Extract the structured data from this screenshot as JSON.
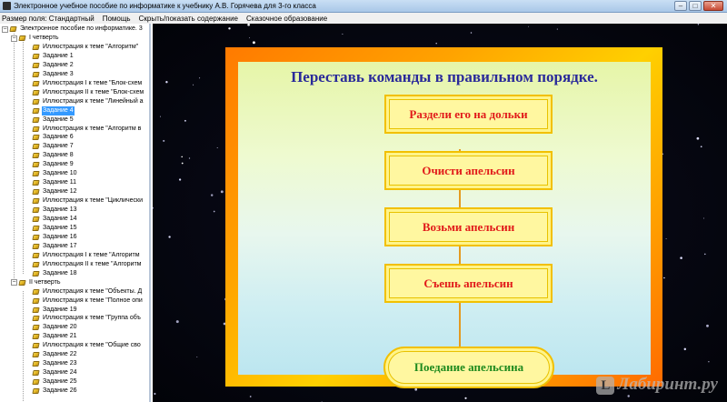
{
  "window": {
    "title": "Электронное учебное пособие по информатике к учебнику А.В. Горячева для 3-го класса",
    "controls": {
      "minimize": "–",
      "maximize": "□",
      "close": "✕"
    }
  },
  "menu": {
    "items": [
      "Размер поля: Стандартный",
      "Помощь",
      "Скрыть/показать содержание",
      "Сказочное образование"
    ]
  },
  "tree": {
    "root": "Электронное пособие по информатике. 3",
    "items": [
      {
        "label": "I четверть",
        "level": 1,
        "expander": "−"
      },
      {
        "label": "Иллюстрация к теме \"Алгоритм\"",
        "level": 2
      },
      {
        "label": "Задание 1",
        "level": 2
      },
      {
        "label": "Задание 2",
        "level": 2
      },
      {
        "label": "Задание 3",
        "level": 2
      },
      {
        "label": "Иллюстрация I к теме \"Блок-схем",
        "level": 2
      },
      {
        "label": "Иллюстрация II к теме \"Блок-схем",
        "level": 2
      },
      {
        "label": "Иллюстрация к теме \"Линейный а",
        "level": 2
      },
      {
        "label": "Задание 4",
        "level": 2,
        "selected": true
      },
      {
        "label": "Задание 5",
        "level": 2
      },
      {
        "label": "Иллюстрация к теме \"Алгоритм в",
        "level": 2
      },
      {
        "label": "Задание 6",
        "level": 2
      },
      {
        "label": "Задание 7",
        "level": 2
      },
      {
        "label": "Задание 8",
        "level": 2
      },
      {
        "label": "Задание 9",
        "level": 2
      },
      {
        "label": "Задание 10",
        "level": 2
      },
      {
        "label": "Задание 11",
        "level": 2
      },
      {
        "label": "Задание 12",
        "level": 2
      },
      {
        "label": "Иллюстрация к теме \"Циклически",
        "level": 2
      },
      {
        "label": "Задание 13",
        "level": 2
      },
      {
        "label": "Задание 14",
        "level": 2
      },
      {
        "label": "Задание 15",
        "level": 2
      },
      {
        "label": "Задание 16",
        "level": 2
      },
      {
        "label": "Задание 17",
        "level": 2
      },
      {
        "label": "Иллюстрация I к теме \"Алгоритм",
        "level": 2
      },
      {
        "label": "Иллюстрация II к теме \"Алгоритм",
        "level": 2
      },
      {
        "label": "Задание 18",
        "level": 2
      },
      {
        "label": "II четверть",
        "level": 1,
        "expander": "−"
      },
      {
        "label": "Иллюстрация к теме \"Объекты. Д",
        "level": 2
      },
      {
        "label": "Иллюстрация к теме \"Полное опи",
        "level": 2
      },
      {
        "label": "Задание 19",
        "level": 2
      },
      {
        "label": "Иллюстрация к теме \"Группа объ",
        "level": 2
      },
      {
        "label": "Задание 20",
        "level": 2
      },
      {
        "label": "Задание 21",
        "level": 2
      },
      {
        "label": "Иллюстрация к теме \"Общие сво",
        "level": 2
      },
      {
        "label": "Задание 22",
        "level": 2
      },
      {
        "label": "Задание 23",
        "level": 2
      },
      {
        "label": "Задание 24",
        "level": 2
      },
      {
        "label": "Задание 25",
        "level": 2
      },
      {
        "label": "Задание 26",
        "level": 2
      }
    ]
  },
  "task": {
    "title": "Переставь команды в правильном порядке.",
    "commands": [
      "Раздели его на дольки",
      "Очисти апельсин",
      "Возьми апельсин",
      "Съешь апельсин"
    ],
    "goal": "Поедание апельсина"
  },
  "watermark": {
    "badge": "L",
    "text": "Лабиринт.ру"
  },
  "colors": {
    "title": "#2a2a9a",
    "command_text": "#e11a1a",
    "goal_text": "#1e8a1e",
    "box_fill": "#fff48a",
    "box_border": "#f2c000",
    "frame": "#ff9a00",
    "selection": "#3399ff"
  }
}
